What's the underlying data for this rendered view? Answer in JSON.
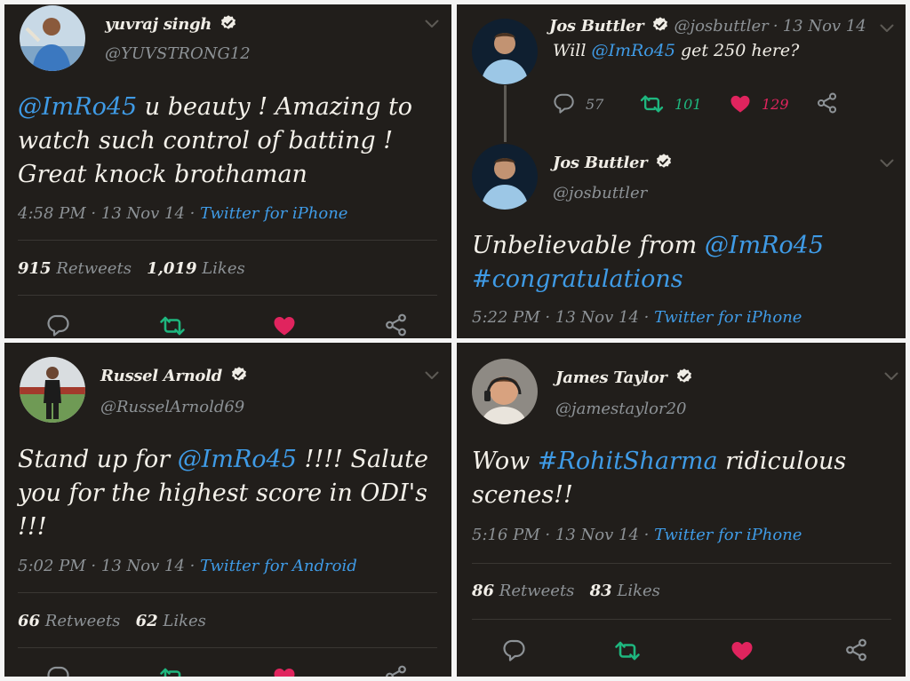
{
  "tweets": [
    {
      "name": "yuvraj singh",
      "handle": "@YUVSTRONG12",
      "text_parts": [
        "@ImRo45",
        " u beauty ! Amazing to watch such control of batting ! Great knock brothaman"
      ],
      "time": "4:58 PM",
      "date": "13 Nov 14",
      "source": "Twitter for iPhone",
      "retweets": "915",
      "retweets_label": "Retweets",
      "likes": "1,019",
      "likes_label": "Likes"
    },
    {
      "reply": {
        "name": "Jos Buttler",
        "handle": "@josbuttler",
        "date": "13 Nov 14",
        "text_parts": [
          "Will ",
          "@ImRo45",
          " get 250 here?"
        ],
        "replies": "57",
        "retweets": "101",
        "likes": "129"
      },
      "name": "Jos Buttler",
      "handle": "@josbuttler",
      "text_parts": [
        "Unbelievable from ",
        "@ImRo45",
        "#congratulations"
      ],
      "time": "5:22 PM",
      "date": "13 Nov 14",
      "source": "Twitter for iPhone"
    },
    {
      "name": "Russel Arnold",
      "handle": "@RusselArnold69",
      "text_parts": [
        "Stand up for ",
        "@ImRo45",
        " !!!! Salute you for the highest score in ODI's !!!"
      ],
      "time": "5:02 PM",
      "date": "13 Nov 14",
      "source": "Twitter for Android",
      "retweets": "66",
      "retweets_label": "Retweets",
      "likes": "62",
      "likes_label": "Likes"
    },
    {
      "name": "James Taylor",
      "handle": "@jamestaylor20",
      "text_parts": [
        "Wow ",
        "#RohitSharma",
        " ridiculous scenes!!"
      ],
      "time": "5:16 PM",
      "date": "13 Nov 14",
      "source": "Twitter for iPhone",
      "retweets": "86",
      "retweets_label": "Retweets",
      "likes": "83",
      "likes_label": "Likes"
    }
  ],
  "separator": "·",
  "colors": {
    "background": "#211e1b",
    "link": "#3f9be6",
    "retweet_green": "#1eb77f",
    "like_red": "#e0245e",
    "muted": "#8d9296"
  },
  "icons": [
    "verified-badge-icon",
    "chevron-down-icon",
    "reply-icon",
    "retweet-icon",
    "like-heart-icon",
    "share-icon"
  ]
}
